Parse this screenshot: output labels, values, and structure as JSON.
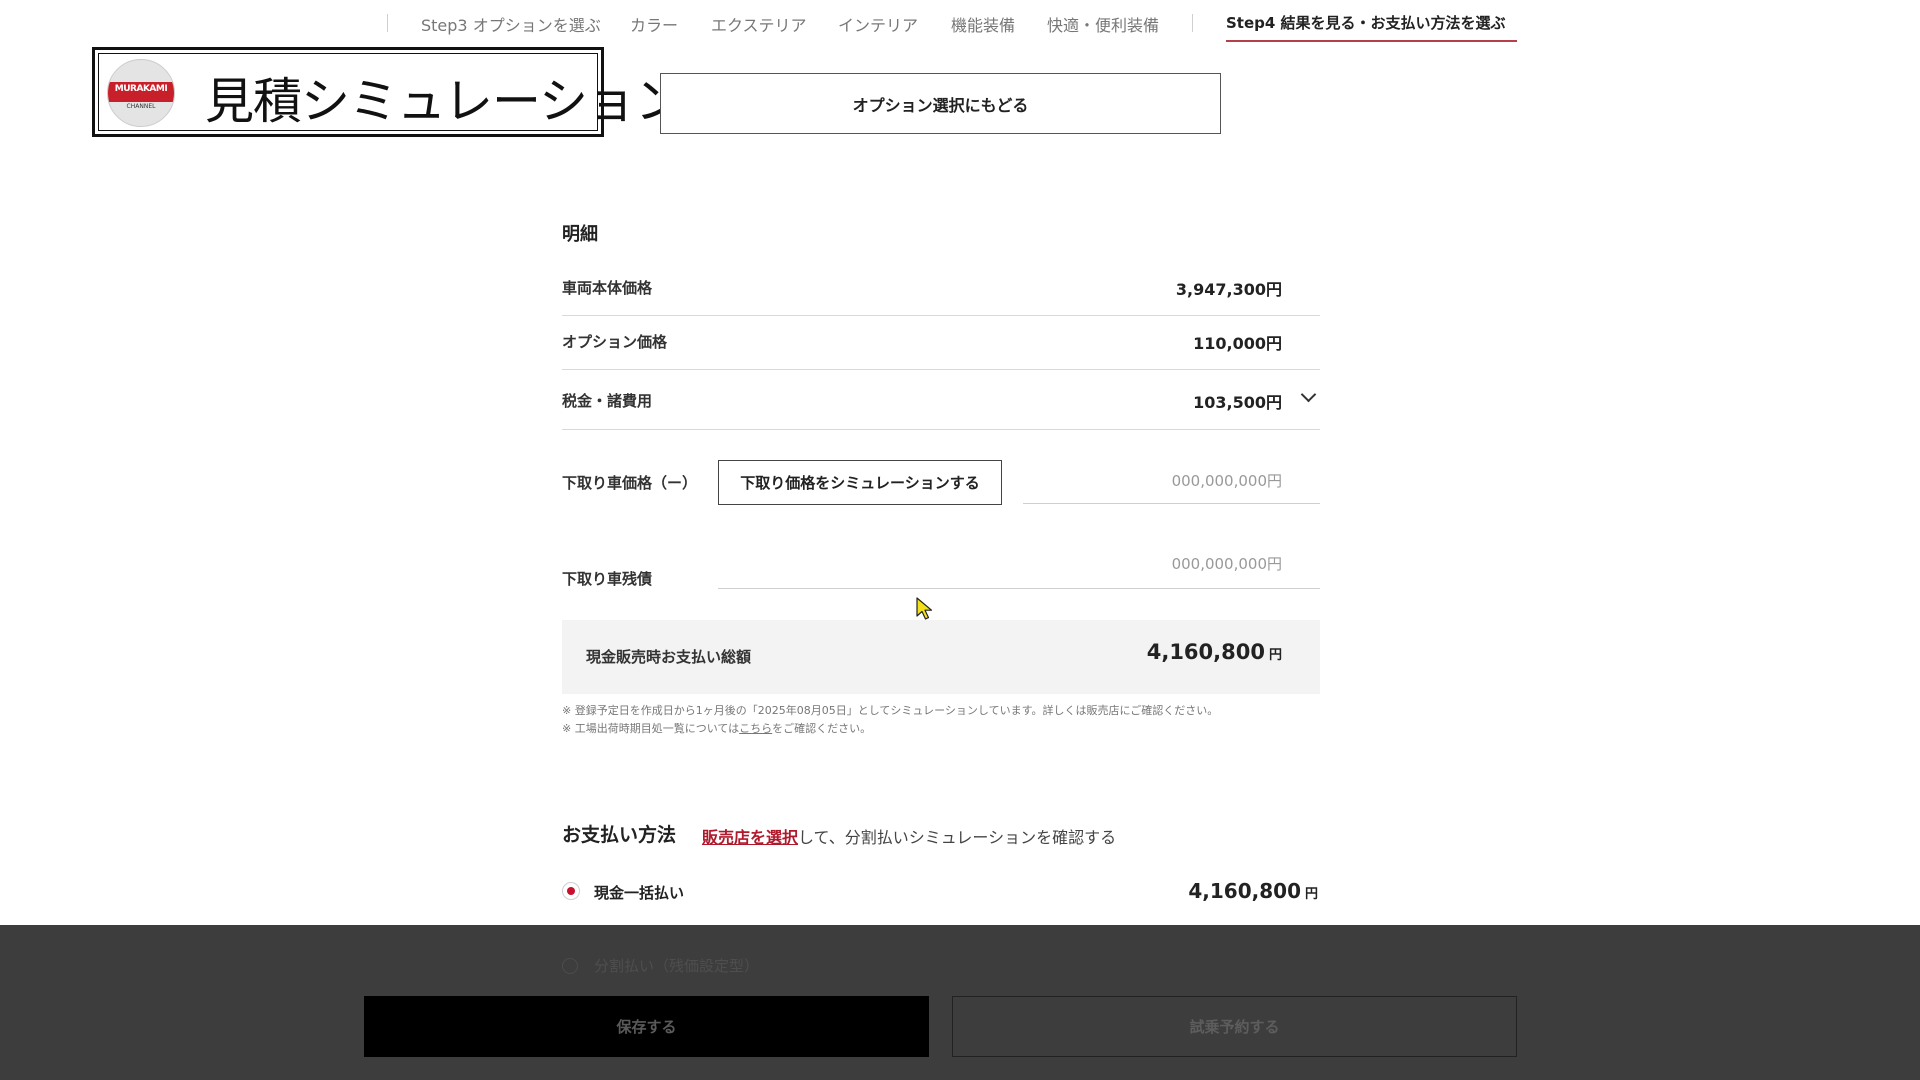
{
  "nav": {
    "items": [
      {
        "label": "Step3 オプションを選ぶ"
      },
      {
        "label": "カラー"
      },
      {
        "label": "エクステリア"
      },
      {
        "label": "インテリア"
      },
      {
        "label": "機能装備"
      },
      {
        "label": "快適・便利装備"
      }
    ],
    "active_step": "Step4 結果を見る・お支払い方法を選ぶ"
  },
  "channel": {
    "logo_text": "MURAKAMI",
    "logo_sub": "CHANNEL",
    "title": "見積シミュレーション"
  },
  "back_button": "オプション選択にもどる",
  "breakdown": {
    "title": "明細",
    "rows": [
      {
        "label": "車両本体価格",
        "value": "3,947,300円"
      },
      {
        "label": "オプション価格",
        "value": "110,000円"
      },
      {
        "label": "税金・諸費用",
        "value": "103,500円"
      }
    ],
    "trade_in_label": "下取り車価格（ー）",
    "trade_in_button": "下取り価格をシミュレーションする",
    "trade_in_placeholder": "000,000,000円",
    "residual_label": "下取り車残債",
    "residual_placeholder": "000,000,000円",
    "total_label": "現金販売時お支払い総額",
    "total_value": "4,160,800",
    "yen": "円",
    "notes": {
      "note1": "※ 登録予定日を作成日から1ヶ月後の「2025年08月05日」としてシミュレーションしています。詳しくは販売店にご確認ください。",
      "note2_prefix": "※ 工場出荷時期目処一覧については",
      "note2_link": "こちら",
      "note2_suffix": "をご確認ください。"
    }
  },
  "payment": {
    "title": "お支払い方法",
    "link_text": "販売店を選択",
    "desc_suffix": "して、分割払いシミュレーションを確認する",
    "option_cash": "現金一括払い",
    "cash_value": "4,160,800",
    "yen": "円",
    "option_installment": "分割払い（残価設定型）"
  },
  "footer": {
    "save_label": "保存する",
    "testdrive_label": "試乗予約する"
  },
  "colors": {
    "accent_red": "#c8102e",
    "nav_underline": "#b5404c",
    "overlay": "#3d3d3d"
  }
}
